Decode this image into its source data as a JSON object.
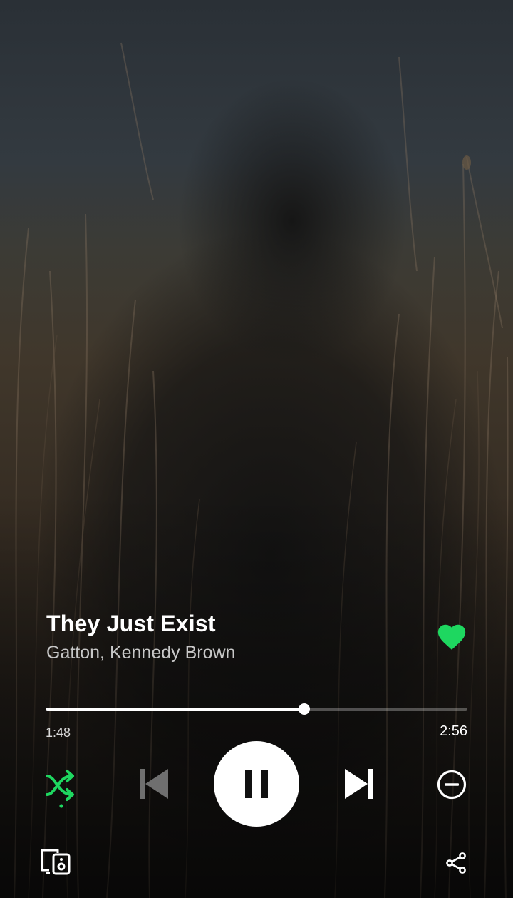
{
  "now_playing": {
    "title": "They Just Exist",
    "artist": "Gatton, Kennedy Brown",
    "liked": true
  },
  "playback": {
    "elapsed": "1:48",
    "duration": "2:56",
    "progress_fraction": 0.614,
    "state": "playing",
    "shuffle": true
  },
  "icons": {
    "like": "heart-icon",
    "shuffle": "shuffle-icon",
    "previous": "skip-previous-icon",
    "pause": "pause-icon",
    "next": "skip-next-icon",
    "remove": "minus-circle-icon",
    "devices": "connect-devices-icon",
    "share": "share-icon"
  },
  "colors": {
    "accent": "#1ed760",
    "text_primary": "#ffffff",
    "text_secondary": "#c8c8c8"
  }
}
